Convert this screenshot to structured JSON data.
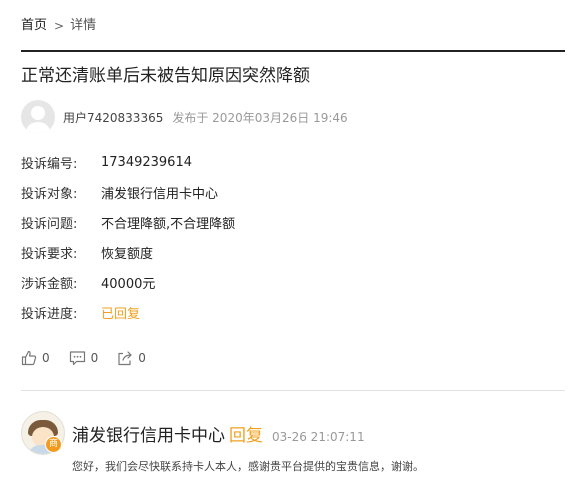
{
  "breadcrumb": {
    "home": "首页",
    "separator": ">",
    "current": "详情"
  },
  "title": "正常还清账单后未被告知原因突然降额",
  "author": {
    "username": "用户7420833365",
    "posted_at": "发布于 2020年03月26日 19:46"
  },
  "info": [
    {
      "label": "投诉编号:",
      "value": "17349239614"
    },
    {
      "label": "投诉对象:",
      "value": "浦发银行信用卡中心"
    },
    {
      "label": "投诉问题:",
      "value": "不合理降额,不合理降额"
    },
    {
      "label": "投诉要求:",
      "value": "恢复额度"
    },
    {
      "label": "涉诉金额:",
      "value": "40000元"
    },
    {
      "label": "投诉进度:",
      "value": "已回复"
    }
  ],
  "actions": {
    "likes": "0",
    "comments": "0",
    "shares": "0"
  },
  "reply": {
    "badge": "商",
    "name": "浦发银行信用卡中心",
    "tag": "回复",
    "time": "03-26 21:07:11",
    "text": "您好，我们会尽快联系持卡人本人，感谢贵平台提供的宝贵信息，谢谢。"
  },
  "colors": {
    "accent": "#f0a020",
    "badge": "#f39b1e",
    "muted": "#999999"
  }
}
